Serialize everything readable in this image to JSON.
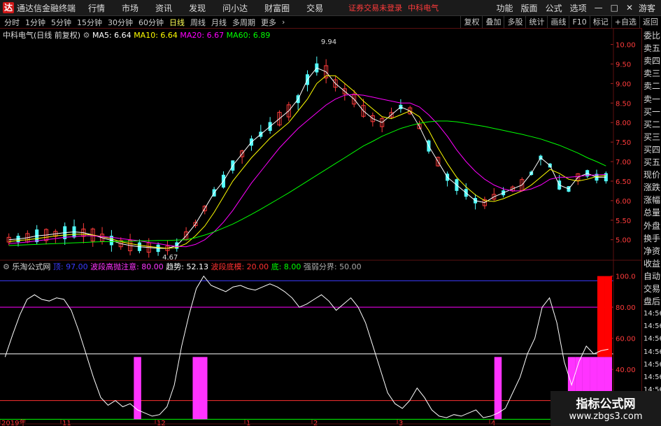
{
  "menubar": {
    "logo_text": "达",
    "app_title": "通达信金融终端",
    "menus": [
      "行情",
      "市场",
      "资讯",
      "发现",
      "问小达",
      "财富圈",
      "交易"
    ],
    "warning": "证券交易未登录",
    "stock_name": "中科电气",
    "right_menus": [
      "功能",
      "版面",
      "公式",
      "选项"
    ],
    "guest": "游客"
  },
  "tabbar": {
    "periods": [
      "分时",
      "1分钟",
      "5分钟",
      "15分钟",
      "30分钟",
      "60分钟",
      "日线",
      "周线",
      "月线",
      "多周期",
      "更多"
    ],
    "active_index": 6,
    "tools": [
      "复权",
      "叠加",
      "多股",
      "统计",
      "画线",
      "F10",
      "标记",
      "+自选",
      "返回"
    ]
  },
  "main_legend": {
    "title": "中科电气(日线 前复权)",
    "ma5": "MA5: 6.64",
    "ma10": "MA10: 6.64",
    "ma20": "MA20: 6.67",
    "ma60": "MA60: 6.89"
  },
  "indicator_legend": {
    "name": "乐淘公式网",
    "v1": "顶: 97.00",
    "v2": "波段高抛注意: 80.00",
    "v3": "趋势: 52.13",
    "v4": "波段底模: 20.00",
    "v5": "底: 8.00",
    "v6": "强弱分界: 50.00"
  },
  "right_panel": [
    "委比",
    "卖五",
    "卖四",
    "卖三",
    "卖二",
    "卖一",
    "买一",
    "买二",
    "买三",
    "买四",
    "买五",
    "现价",
    "涨跌",
    "涨幅",
    "总量",
    "外盘",
    "换手",
    "净资",
    "收益",
    "自动",
    "交易",
    "盘后",
    "14:56",
    "14:56",
    "14:56",
    "14:56",
    "14:56",
    "14:56",
    "14:56",
    "14:56",
    "14:56"
  ],
  "watermark": {
    "title": "指标公式网",
    "url": "www.zbgs3.com"
  },
  "colors": {
    "up": "#ff3b3b",
    "down": "#54ffff",
    "ma5": "#ffffff",
    "ma10": "#ffff00",
    "ma20": "#ff00ff",
    "ma60": "#00ff00",
    "bg": "#000000"
  },
  "chart_data": [
    {
      "type": "candlestick",
      "y_axis_labels": [
        "10.00",
        "9.50",
        "9.00",
        "8.50",
        "8.00",
        "7.50",
        "7.00",
        "6.50",
        "6.00",
        "5.50",
        "5.00"
      ],
      "ylim": [
        4.6,
        10.1
      ],
      "annotations": [
        {
          "label": "9.94",
          "value": 9.94
        },
        {
          "label": "4.67",
          "value": 4.67
        }
      ],
      "x_labels": [
        "2019年",
        "11",
        "12",
        "1",
        "2",
        "3",
        "4"
      ],
      "series": [
        {
          "name": "MA5",
          "values": [
            5.0,
            5.02,
            5.05,
            5.1,
            5.12,
            5.15,
            5.18,
            5.2,
            5.18,
            5.12,
            5.05,
            4.98,
            4.9,
            4.85,
            4.82,
            4.8,
            4.78,
            4.78,
            4.85,
            5.1,
            5.4,
            5.8,
            6.2,
            6.5,
            6.9,
            7.2,
            7.5,
            7.7,
            7.9,
            8.1,
            8.3,
            8.6,
            9.1,
            9.4,
            9.3,
            9.0,
            8.8,
            8.6,
            8.3,
            8.1,
            8.0,
            8.2,
            8.4,
            8.3,
            7.9,
            7.4,
            7.0,
            6.6,
            6.4,
            6.2,
            6.0,
            5.95,
            6.1,
            6.2,
            6.3,
            6.4,
            6.7,
            7.1,
            6.9,
            6.4,
            6.3,
            6.6,
            6.7,
            6.6,
            6.6
          ]
        },
        {
          "name": "MA10",
          "values": [
            4.95,
            4.98,
            5.0,
            5.03,
            5.06,
            5.1,
            5.12,
            5.14,
            5.14,
            5.12,
            5.08,
            5.02,
            4.95,
            4.9,
            4.86,
            4.83,
            4.8,
            4.78,
            4.8,
            4.9,
            5.1,
            5.35,
            5.7,
            6.1,
            6.5,
            6.8,
            7.1,
            7.35,
            7.6,
            7.8,
            8.0,
            8.3,
            8.6,
            9.0,
            9.2,
            9.2,
            9.0,
            8.8,
            8.55,
            8.35,
            8.15,
            8.1,
            8.2,
            8.3,
            8.15,
            7.8,
            7.35,
            6.95,
            6.6,
            6.35,
            6.15,
            6.0,
            5.98,
            6.05,
            6.15,
            6.25,
            6.4,
            6.6,
            6.8,
            6.7,
            6.55,
            6.5,
            6.55,
            6.62,
            6.64
          ]
        },
        {
          "name": "MA20",
          "values": [
            4.9,
            4.92,
            4.94,
            4.97,
            5.0,
            5.03,
            5.06,
            5.08,
            5.1,
            5.1,
            5.08,
            5.06,
            5.03,
            5.0,
            4.97,
            4.93,
            4.9,
            4.86,
            4.83,
            4.82,
            4.88,
            5.0,
            5.2,
            5.45,
            5.75,
            6.1,
            6.45,
            6.75,
            7.05,
            7.35,
            7.6,
            7.85,
            8.05,
            8.25,
            8.45,
            8.6,
            8.7,
            8.72,
            8.7,
            8.65,
            8.6,
            8.55,
            8.5,
            8.5,
            8.4,
            8.2,
            7.95,
            7.65,
            7.3,
            7.0,
            6.75,
            6.55,
            6.4,
            6.3,
            6.25,
            6.25,
            6.3,
            6.4,
            6.55,
            6.6,
            6.6,
            6.62,
            6.65,
            6.66,
            6.67
          ]
        },
        {
          "name": "MA60",
          "values": [
            4.85,
            4.86,
            4.87,
            4.88,
            4.89,
            4.9,
            4.91,
            4.92,
            4.93,
            4.94,
            4.95,
            4.95,
            4.96,
            4.96,
            4.97,
            4.97,
            4.98,
            4.98,
            4.99,
            5.0,
            5.05,
            5.12,
            5.2,
            5.3,
            5.4,
            5.52,
            5.65,
            5.78,
            5.92,
            6.06,
            6.2,
            6.35,
            6.5,
            6.65,
            6.8,
            6.95,
            7.1,
            7.25,
            7.4,
            7.52,
            7.65,
            7.75,
            7.85,
            7.92,
            7.98,
            8.02,
            8.04,
            8.04,
            8.02,
            7.98,
            7.94,
            7.9,
            7.85,
            7.8,
            7.75,
            7.7,
            7.64,
            7.58,
            7.5,
            7.42,
            7.32,
            7.22,
            7.1,
            7.0,
            6.89
          ]
        }
      ]
    },
    {
      "type": "line",
      "y_axis_labels": [
        "100.0",
        "80.00",
        "60.00",
        "40.00",
        "20.00"
      ],
      "ylim": [
        5,
        103
      ],
      "hlines": [
        {
          "name": "顶",
          "value": 97,
          "color": "#3b3bff"
        },
        {
          "name": "波段高抛注意",
          "value": 80,
          "color": "#ff00ff"
        },
        {
          "name": "强弱分界",
          "value": 50,
          "color": "#ffffff"
        },
        {
          "name": "波段底模",
          "value": 20,
          "color": "#ff3030"
        },
        {
          "name": "底",
          "value": 8,
          "color": "#00ff00"
        }
      ],
      "series": [
        {
          "name": "趋势",
          "values": [
            48,
            62,
            75,
            85,
            88,
            85,
            84,
            86,
            85,
            78,
            65,
            50,
            35,
            22,
            17,
            20,
            16,
            18,
            14,
            12,
            10,
            11,
            16,
            30,
            55,
            75,
            92,
            100,
            94,
            92,
            90,
            93,
            94,
            92,
            91,
            93,
            95,
            93,
            90,
            86,
            80,
            82,
            85,
            88,
            84,
            78,
            82,
            86,
            80,
            70,
            55,
            40,
            25,
            18,
            15,
            20,
            28,
            22,
            14,
            10,
            9,
            11,
            10,
            12,
            14,
            9,
            10,
            12,
            15,
            25,
            35,
            50,
            60,
            80,
            86,
            70,
            45,
            30,
            45,
            55,
            50,
            52,
            53
          ]
        }
      ],
      "bars": [
        {
          "color": "#ff33ff",
          "x_index": 18,
          "from": 8,
          "to": 48
        },
        {
          "color": "#ff33ff",
          "x_index": 26,
          "from": 8,
          "to": 48
        },
        {
          "color": "#ff33ff",
          "x_index": 27,
          "from": 8,
          "to": 48
        },
        {
          "color": "#ff33ff",
          "x_index": 67,
          "from": 8,
          "to": 48
        },
        {
          "color": "#ff33ff",
          "x_index": 77,
          "from": 8,
          "to": 48
        },
        {
          "color": "#ff33ff",
          "x_index": 78,
          "from": 8,
          "to": 48
        },
        {
          "color": "#ff33ff",
          "x_index": 79,
          "from": 8,
          "to": 48
        },
        {
          "color": "#ff33ff",
          "x_index": 80,
          "from": 8,
          "to": 48
        },
        {
          "color": "#ff0000",
          "x_index": 81,
          "from": 48,
          "to": 100
        },
        {
          "color": "#ff0000",
          "x_index": 82,
          "from": 48,
          "to": 100
        },
        {
          "color": "#ff33ff",
          "x_index": 81,
          "from": 8,
          "to": 48
        },
        {
          "color": "#ff33ff",
          "x_index": 82,
          "from": 8,
          "to": 48
        },
        {
          "color": "#ff33ff",
          "x_index": 87,
          "from": 8,
          "to": 48
        }
      ]
    }
  ]
}
